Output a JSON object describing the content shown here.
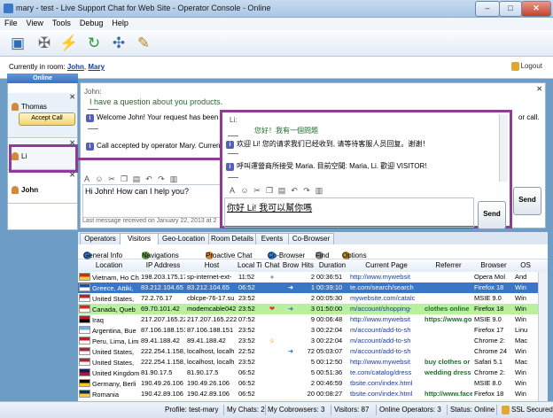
{
  "window": {
    "title": "mary - test - Live Support Chat for Web Site - Operator Console - Online",
    "min": "–",
    "max": "□",
    "close": "✕"
  },
  "menu": [
    "File",
    "View",
    "Tools",
    "Debug",
    "Help"
  ],
  "toolbar_icons": [
    "monitor-icon",
    "tools-icon",
    "run-icon",
    "refresh-icon",
    "network-icon",
    "edit-icon"
  ],
  "room": {
    "label": "Currently in room:",
    "user1": "John",
    "sep": ",",
    "user2": "Mary",
    "logout": "Logout"
  },
  "sidebar": {
    "online_label": "Online",
    "chats": [
      {
        "name": "Thomas",
        "accept": "Accept Call"
      },
      {
        "name": "Li"
      },
      {
        "name": "John"
      }
    ]
  },
  "john_chat": {
    "speaker": "John:",
    "message": "I have a question about you products.",
    "system1": "Welcome John! Your request has been",
    "system1_tail": "or call.",
    "system2": "Call accepted by operator Mary. Curren",
    "input": "Hi John! How can I help you?",
    "last_received": "Last message received on January 22, 2013 at 2",
    "send": "Send"
  },
  "li_chat": {
    "speaker": "Li:",
    "message": "您好！我有一個問題",
    "system1": "欢迎 Li! 您的请求我们已经收到, 请等待客服人员回复。谢谢！",
    "system2": "呼叫運營商所接受 Maria. 目前空間: Maria, Li. 歡迎 VISITOR!",
    "input": "你好 Li! 我可以幫你嗎",
    "send": "Send"
  },
  "tabs": [
    "Operators",
    "Visitors",
    "Geo-Location",
    "Room Details",
    "Events",
    "Co-Browser"
  ],
  "active_tab": "Visitors",
  "subtoolbar": [
    "General Info",
    "Navigations",
    "Proactive Chat",
    "Co-Browser",
    "Find",
    "Options"
  ],
  "columns": [
    "Location",
    "IP Address",
    "Host",
    "Local Time",
    "Chat",
    "Brow",
    "Hits",
    "Duration",
    "Current Page",
    "Referrer",
    "Browser",
    "OS"
  ],
  "rows": [
    {
      "flag": [
        "#d8261c",
        "#f7d21a"
      ],
      "location": "Vietnam, Ho Chi",
      "ip": "198.203.175.17",
      "host": "sp-internet-ext-",
      "time": "11:52",
      "chat": "grey",
      "brow": "",
      "hits": "2",
      "duration": "00:36:51",
      "page": "http://www.mywebsit",
      "ref": "",
      "browser": "Opera Mol",
      "os": "And",
      "bg": "#ffffff"
    },
    {
      "flag": [
        "#1f4fa3",
        "#ffffff"
      ],
      "location": "Greece, Attiki,",
      "ip": "83.212.104.65",
      "host": "83.212.104.65",
      "time": "06:52",
      "chat": "",
      "brow": "arrow",
      "hits": "1",
      "duration": "00:39:10",
      "page": "te.com/search/search",
      "ref": "",
      "browser": "Firefox 18",
      "os": "Win",
      "bg": "#3a75c7",
      "sel": true
    },
    {
      "flag": [
        "#b22234",
        "#ffffff"
      ],
      "location": "United States,",
      "ip": "72.2.76.17",
      "host": "cblcpe-76-17.su",
      "time": "23:52",
      "chat": "",
      "brow": "",
      "hits": "2",
      "duration": "00:05:30",
      "page": "mywebsite.com/catalc",
      "ref": "",
      "browser": "MSIE 9.0",
      "os": "Win",
      "bg": "#ffffff"
    },
    {
      "flag": [
        "#d52b1e",
        "#ffffff"
      ],
      "location": "Canada, Queb",
      "ip": "69.70.101.42",
      "host": "modemcable042",
      "time": "23:52",
      "chat": "heart",
      "brow": "arrow",
      "hits": "3",
      "duration": "01:50:00",
      "page": "m/account/shopping-",
      "ref": "clothes online",
      "browser": "Firefox 18",
      "os": "Win",
      "bg": "#b8f0a0"
    },
    {
      "flag": [
        "#ce1126",
        "#000000"
      ],
      "location": "Iraq",
      "ip": "217.207.165.222",
      "host": "217.207.165.222",
      "time": "07:52",
      "chat": "",
      "brow": "",
      "hits": "9",
      "duration": "00:06:48",
      "page": "http://www.mywebsit",
      "ref": "https://www.go",
      "browser": "MSIE 9.0",
      "os": "Win",
      "bg": "#ffffff"
    },
    {
      "flag": [
        "#74acdf",
        "#ffffff"
      ],
      "location": "Argentina, Bue",
      "ip": "87.106.188.151",
      "host": "87.106.188.151",
      "time": "23:52",
      "chat": "",
      "brow": "",
      "hits": "3",
      "duration": "00:22:04",
      "page": "m/account/add-to-sh",
      "ref": "",
      "browser": "Firefox 17",
      "os": "Linu",
      "bg": "#ffffff"
    },
    {
      "flag": [
        "#d91023",
        "#ffffff"
      ],
      "location": "Peru, Lima, Lim",
      "ip": "89.41.188.42",
      "host": "89.41.188.42",
      "time": "23:52",
      "chat": "smile",
      "brow": "",
      "hits": "3",
      "duration": "00:22:04",
      "page": "m/account/add-to-sh",
      "ref": "",
      "browser": "Chrome 2:",
      "os": "Mac",
      "bg": "#ffffff"
    },
    {
      "flag": [
        "#b22234",
        "#ffffff"
      ],
      "location": "United States,",
      "ip": "222.254.1.158,",
      "host": "localhost, localh",
      "time": "22:52",
      "chat": "",
      "brow": "arrow",
      "hits": "72",
      "duration": "05:03:07",
      "page": "m/account/add-to-sh",
      "ref": "",
      "browser": "Chrome 24",
      "os": "Win",
      "bg": "#ffffff"
    },
    {
      "flag": [
        "#b22234",
        "#ffffff"
      ],
      "location": "United States,",
      "ip": "222.254.1.158,",
      "host": "localhost, localh",
      "time": "23:52",
      "chat": "",
      "brow": "",
      "hits": "5",
      "duration": "00:12:50",
      "page": "http://www.mywebsit",
      "ref": "buy clothes or",
      "browser": "Safari 5.1",
      "os": "Mac",
      "bg": "#ffffff"
    },
    {
      "flag": [
        "#012169",
        "#c8102e"
      ],
      "location": "United Kingdom",
      "ip": "81.90.17.5",
      "host": "81.90.17.5",
      "time": "06:52",
      "chat": "",
      "brow": "",
      "hits": "5",
      "duration": "00:51:36",
      "page": "te.com/catalog/dress",
      "ref": "wedding dress",
      "browser": "Chrome 2:",
      "os": "Win",
      "bg": "#ffffff"
    },
    {
      "flag": [
        "#000000",
        "#ffce00"
      ],
      "location": "Germany, Berli",
      "ip": "190.49.26.106",
      "host": "190.49.26.106",
      "time": "06:52",
      "chat": "",
      "brow": "",
      "hits": "2",
      "duration": "00:46:59",
      "page": "tbsite.com/index.html",
      "ref": "",
      "browser": "MSIE 8.0",
      "os": "Win",
      "bg": "#ffffff"
    },
    {
      "flag": [
        "#002b7f",
        "#fcd116"
      ],
      "location": "Romania",
      "ip": "190.42.89.106",
      "host": "190.42.89.106",
      "time": "06:52",
      "chat": "",
      "brow": "",
      "hits": "20",
      "duration": "00:08:27",
      "page": "tbsite.com/index.html",
      "ref": "http://www.face",
      "browser": "Firefox 18",
      "os": "Win",
      "bg": "#ffffff"
    }
  ],
  "status": {
    "profile": "Profile: test-mary",
    "chats": "My Chats: 2",
    "cobrowsers": "My Cobrowsers: 3",
    "visitors": "Visitors: 87",
    "operators": "Online Operators: 3",
    "status": "Status: Online",
    "ssl": "SSL Secured"
  }
}
